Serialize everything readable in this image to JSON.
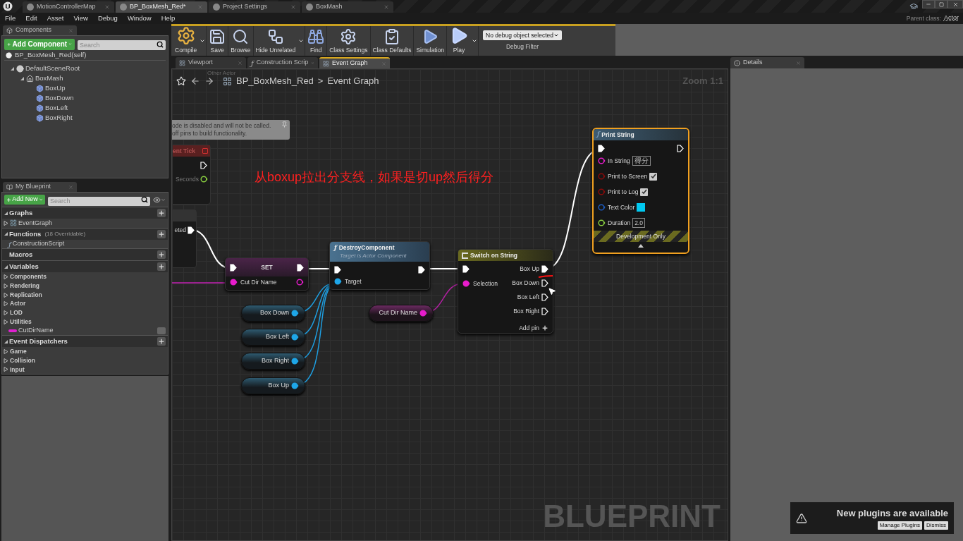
{
  "title_tabs": [
    {
      "label": "MotionControllerMap",
      "selected": false
    },
    {
      "label": "BP_BoxMesh_Red*",
      "selected": true
    },
    {
      "label": "Project Settings",
      "selected": false
    },
    {
      "label": "BoxMash",
      "selected": false
    }
  ],
  "menu": [
    "File",
    "Edit",
    "Asset",
    "View",
    "Debug",
    "Window",
    "Help"
  ],
  "parent_class": {
    "label": "Parent class:",
    "value": "Actor"
  },
  "components_panel": {
    "tab": "Components",
    "add_button": "Add Component",
    "search_placeholder": "Search",
    "self_item": "BP_BoxMesh_Red(self)",
    "tree": [
      {
        "label": "DefaultSceneRoot",
        "kind": "root",
        "expanded": true,
        "children": [
          {
            "label": "BoxMash",
            "kind": "mesh",
            "expanded": true,
            "children": [
              {
                "label": "BoxUp",
                "kind": "box"
              },
              {
                "label": "BoxDown",
                "kind": "box"
              },
              {
                "label": "BoxLeft",
                "kind": "box"
              },
              {
                "label": "BoxRight",
                "kind": "box"
              }
            ]
          }
        ]
      }
    ]
  },
  "my_blueprint": {
    "tab": "My Blueprint",
    "add_button": "Add New",
    "search_placeholder": "Search",
    "sections": [
      {
        "title": "Graphs",
        "items": [
          {
            "label": "EventGraph",
            "kind": "graph"
          }
        ]
      },
      {
        "title": "Functions",
        "note": "(18 Overridable)",
        "items": [
          {
            "label": "ConstructionScript",
            "kind": "function",
            "icon": "ƒ"
          }
        ]
      },
      {
        "title": "Macros"
      },
      {
        "title": "Variables",
        "items": [
          {
            "label": "Components",
            "kind": "category"
          },
          {
            "label": "Rendering",
            "kind": "category"
          },
          {
            "label": "Replication",
            "kind": "category"
          },
          {
            "label": "Actor",
            "kind": "category"
          },
          {
            "label": "LOD",
            "kind": "category"
          },
          {
            "label": "Utilities",
            "kind": "category"
          },
          {
            "label": "CutDirName",
            "kind": "variable"
          }
        ]
      },
      {
        "title": "Event Dispatchers",
        "items": [
          {
            "label": "Game",
            "kind": "category"
          },
          {
            "label": "Collision",
            "kind": "category"
          },
          {
            "label": "Input",
            "kind": "category"
          }
        ]
      }
    ]
  },
  "toolbar": [
    {
      "label": "Compile",
      "kind": "compile",
      "dropdown": true
    },
    {
      "label": "Save",
      "kind": "save",
      "dropdown": false
    },
    {
      "label": "Browse",
      "kind": "browse",
      "dropdown": false
    },
    {
      "label": "Hide Unrelated",
      "kind": "hide",
      "dropdown": true
    },
    {
      "label": "Find",
      "kind": "find",
      "dropdown": false
    },
    {
      "label": "Class Settings",
      "kind": "settings",
      "dropdown": false
    },
    {
      "label": "Class Defaults",
      "kind": "defaults",
      "dropdown": false
    },
    {
      "label": "Simulation",
      "kind": "simulation",
      "dropdown": false
    },
    {
      "label": "Play",
      "kind": "play",
      "dropdown": true
    }
  ],
  "debug_filter": {
    "value": "No debug object selected",
    "label": "Debug Filter"
  },
  "editor_tabs": [
    {
      "label": "Viewport",
      "kind": "viewport",
      "selected": false
    },
    {
      "label": "Construction Scrip",
      "kind": "function",
      "icon": "ƒ",
      "selected": false
    },
    {
      "label": "Event Graph",
      "kind": "graph",
      "selected": true
    }
  ],
  "details_tab": "Details",
  "graph": {
    "hint": "Other Actor",
    "breadcrumb": [
      "BP_BoxMesh_Red",
      "Event Graph"
    ],
    "separator": ">",
    "zoom": "Zoom 1:1",
    "disabled_comment": [
      "ode is disabled and will not be called.",
      "off pins to build functionality."
    ],
    "event_tick": {
      "title": "ent Tick",
      "pin": "Seconds"
    },
    "partial_node": {
      "pin": "eted"
    },
    "set_node": {
      "title": "SET",
      "pin": "Cut Dir Name"
    },
    "destroy_node": {
      "icon": "ƒ",
      "title": "DestroyComponent",
      "subtitle": "Target is Actor Component",
      "pin": "Target"
    },
    "getters": [
      "Box Down",
      "Box Left",
      "Box Right",
      "Box Up"
    ],
    "selection_getter": "Cut Dir Name",
    "switch_node": {
      "title": "Switch on String",
      "input": "Selection",
      "outputs": [
        {
          "label": "Box Up",
          "connected": true
        },
        {
          "label": "Box Down",
          "connected": false
        },
        {
          "label": "Box Left",
          "connected": false
        },
        {
          "label": "Box Right",
          "connected": false
        }
      ],
      "add_pin": "Add pin"
    },
    "print_node": {
      "icon": "ƒ",
      "title": "Print String",
      "selected": true,
      "pins": [
        {
          "kind": "string",
          "label": "In String",
          "value": "得分"
        },
        {
          "kind": "bool",
          "label": "Print to Screen",
          "checked": true
        },
        {
          "kind": "bool",
          "label": "Print to Log",
          "checked": true
        },
        {
          "kind": "color",
          "label": "Text Color",
          "color": "#00c8f0"
        },
        {
          "kind": "float",
          "label": "Duration",
          "value": "2.0"
        }
      ],
      "footer": "Development Only"
    },
    "annotation": "从boxup拉出分支线，如果是切up然后得分",
    "label": "BLUEPRINT"
  },
  "notification": {
    "title": "New plugins are available",
    "buttons": [
      "Manage Plugins",
      "Dismiss"
    ]
  }
}
